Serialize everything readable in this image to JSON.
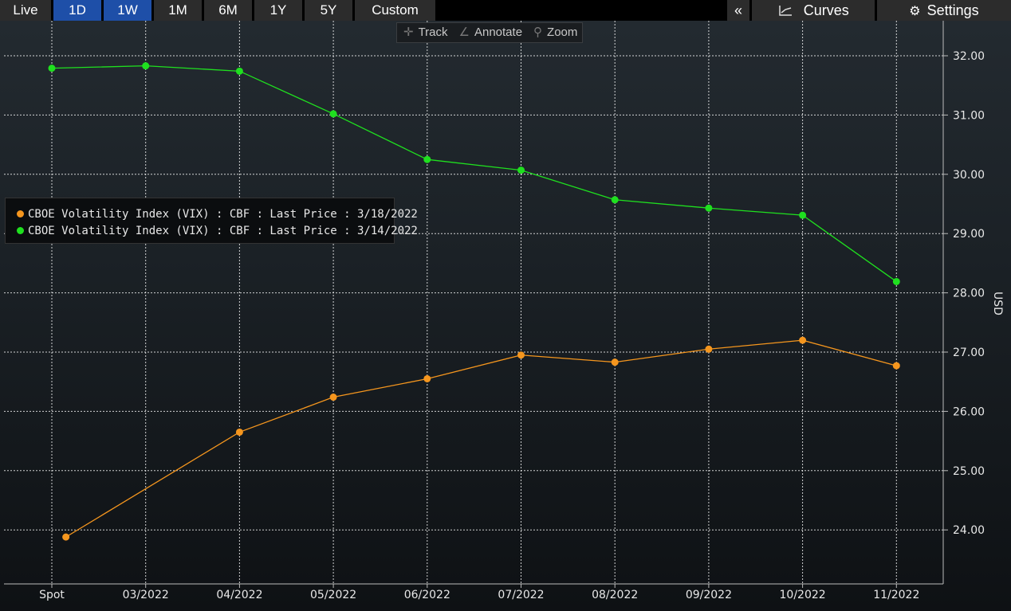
{
  "toolbar": {
    "ranges": [
      {
        "label": "Live",
        "active": false
      },
      {
        "label": "1D",
        "active": true
      },
      {
        "label": "1W",
        "active": true
      },
      {
        "label": "1M",
        "active": false
      },
      {
        "label": "6M",
        "active": false
      },
      {
        "label": "1Y",
        "active": false
      },
      {
        "label": "5Y",
        "active": false
      },
      {
        "label": "Custom",
        "active": false
      }
    ],
    "collapse_label": "«",
    "curves_label": "Curves",
    "settings_label": "Settings"
  },
  "chart_tools": {
    "track_label": "Track",
    "annotate_label": "Annotate",
    "zoom_label": "Zoom"
  },
  "colors": {
    "series_1": "#f5961e",
    "series_2": "#1fe01f",
    "grid": "#ffffff"
  },
  "chart_data": {
    "type": "line",
    "categories": [
      "Spot",
      "03/2022",
      "04/2022",
      "05/2022",
      "06/2022",
      "07/2022",
      "08/2022",
      "09/2022",
      "10/2022",
      "11/2022"
    ],
    "series": [
      {
        "name": "CBOE Volatility Index (VIX) : CBF : Last Price : 3/18/2022",
        "color": "#f5961e",
        "x_offset": 0.15,
        "values": [
          23.88,
          null,
          25.65,
          26.24,
          26.55,
          26.95,
          26.83,
          27.05,
          27.2,
          26.77
        ]
      },
      {
        "name": "CBOE Volatility Index (VIX) : CBF : Last Price : 3/14/2022",
        "color": "#1fe01f",
        "x_offset": 0.0,
        "values": [
          31.79,
          31.83,
          31.74,
          31.02,
          30.25,
          30.07,
          29.57,
          29.43,
          29.31,
          28.19
        ]
      }
    ],
    "ylim": [
      23.0,
      32.5
    ],
    "yticks": [
      "24.00",
      "25.00",
      "26.00",
      "27.00",
      "28.00",
      "29.00",
      "30.00",
      "31.00",
      "32.00"
    ],
    "ylabel": "USD",
    "grid": true,
    "legend_position": "middle-left"
  }
}
